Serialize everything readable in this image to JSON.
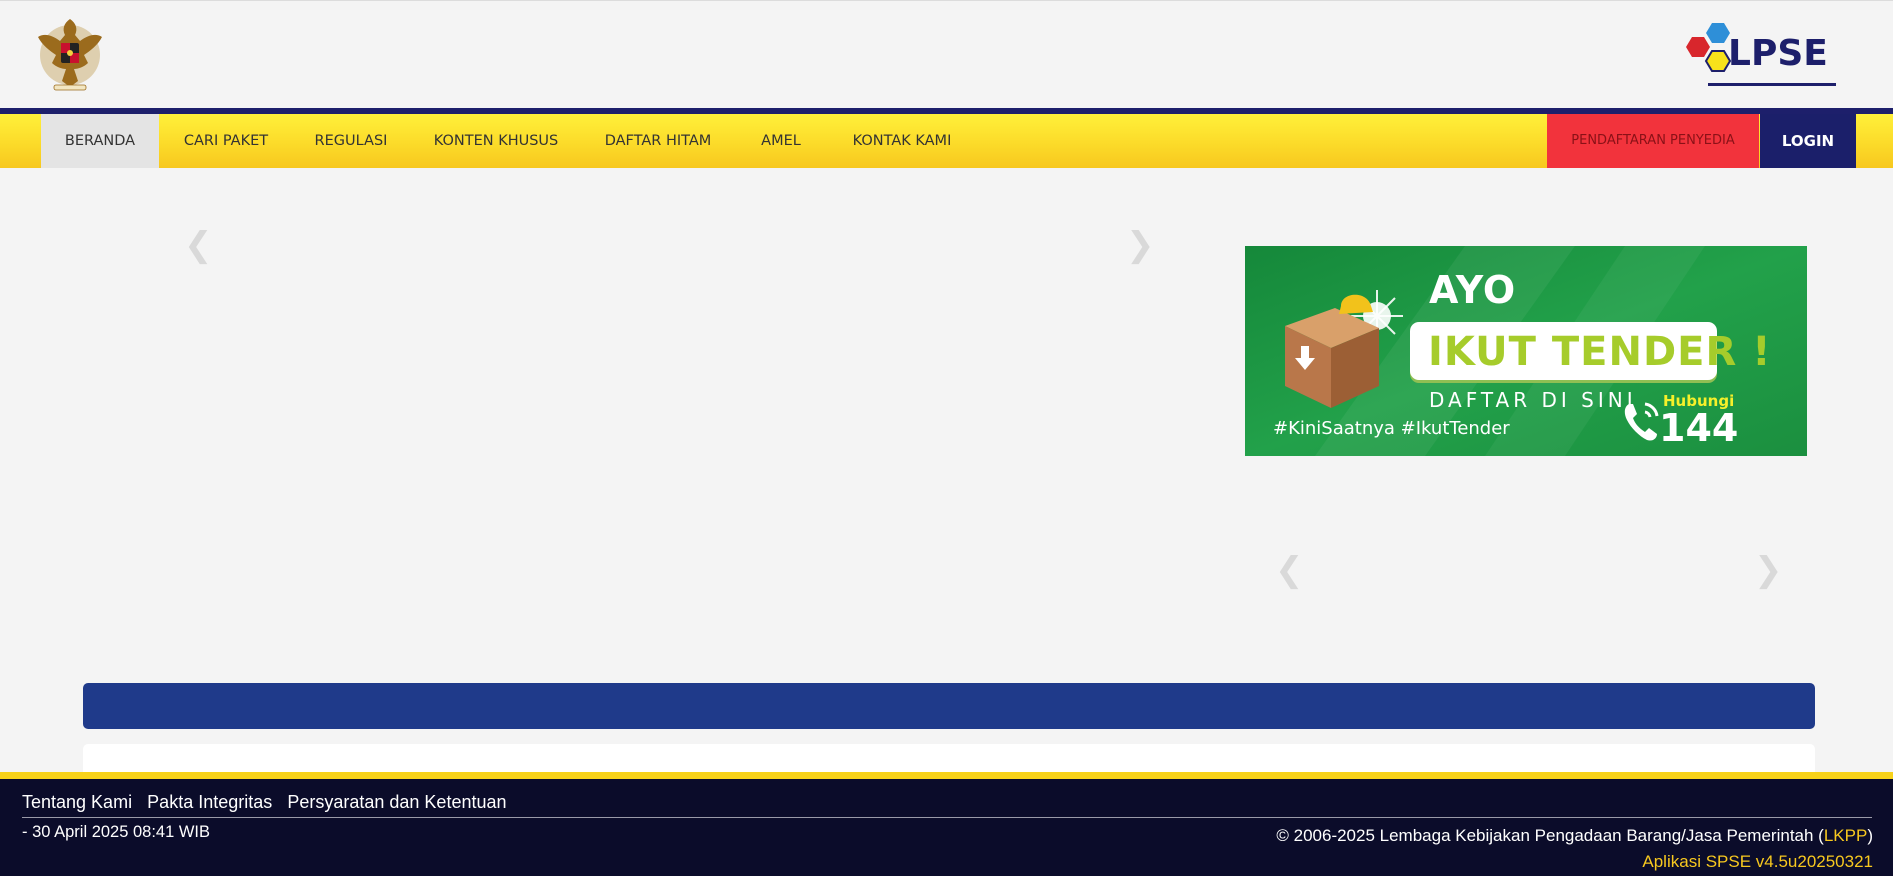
{
  "header": {
    "left_logo_icon": "garuda-emblem-icon",
    "right_logo_text": "LPSE",
    "right_logo_icon": "lpse-hexagon-logo-icon"
  },
  "nav": {
    "items": [
      {
        "label": "BERANDA",
        "active": true
      },
      {
        "label": "CARI PAKET"
      },
      {
        "label": "REGULASI"
      },
      {
        "label": "KONTEN KHUSUS"
      },
      {
        "label": "DAFTAR HITAM"
      },
      {
        "label": "AMEL"
      },
      {
        "label": "KONTAK KAMI"
      }
    ],
    "register_label": "PENDAFTARAN PENYEDIA",
    "login_label": "LOGIN"
  },
  "carousel": {
    "prev_icon": "chevron-left-icon",
    "next_icon": "chevron-right-icon"
  },
  "banner": {
    "line1": "AYO",
    "line2": "IKUT TENDER !",
    "line3": "DAFTAR DI SINI",
    "hashtags": "#KiniSaatnya #IkutTender",
    "hotline_label": "Hubungi",
    "hotline_number": "144",
    "phone_icon": "phone-icon",
    "box_icon": "package-box-icon"
  },
  "footer": {
    "links": [
      "Tentang Kami",
      "Pakta Integritas",
      "Persyaratan dan Ketentuan"
    ],
    "date": "- 30 April 2025 08:41 WIB",
    "copyright_prefix": "© 2006-2025 Lembaga Kebijakan Pengadaan Barang/Jasa Pemerintah (",
    "copyright_link": "LKPP",
    "copyright_suffix": ")",
    "version": "Aplikasi SPSE v4.5u20250321"
  },
  "colors": {
    "nav_yellow": "#fbd928",
    "nav_dark": "#1b1f6a",
    "register_red": "#f2333c",
    "strip_blue": "#1f3a8a",
    "footer_bg": "#0b0c2a",
    "accent_gold": "#f7c81f",
    "banner_green": "#1f9a44"
  }
}
